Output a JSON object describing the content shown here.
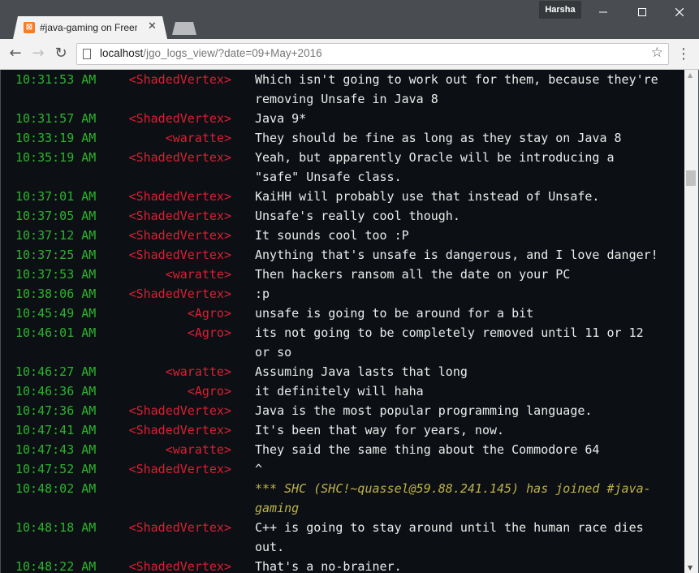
{
  "window": {
    "profile_name": "Harsha",
    "minimize_icon": "minimize-icon",
    "maximize_icon": "maximize-icon",
    "close_icon": "close-icon"
  },
  "tab": {
    "favicon_glyph": "⊠",
    "title": "#java-gaming on Freenode",
    "close_glyph": "✕"
  },
  "toolbar": {
    "back_glyph": "←",
    "forward_glyph": "→",
    "reload_glyph": "↻",
    "url_host": "localhost",
    "url_rest": "/jgo_logs_view/?date=09+May+2016",
    "star_glyph": "☆",
    "menu_glyph": "⋮"
  },
  "colors": {
    "timestamp": "#2bb52b",
    "nick": "#dc1e34",
    "message": "#ebebeb",
    "join_notice": "#bfb248",
    "log_background": "#0c1014"
  },
  "log": [
    {
      "time": "10:31:53 AM",
      "nick": "<ShadedVertex>",
      "text": "Which isn't going to work out for them, because they're removing Unsafe in Java 8"
    },
    {
      "time": "10:31:57 AM",
      "nick": "<ShadedVertex>",
      "text": "Java 9*"
    },
    {
      "time": "10:33:19 AM",
      "nick": "<waratte>",
      "text": "They should be fine as long as they stay on Java 8"
    },
    {
      "time": "10:35:19 AM",
      "nick": "<ShadedVertex>",
      "text": "Yeah, but apparently Oracle will be introducing a \"safe\" Unsafe class."
    },
    {
      "time": "10:37:01 AM",
      "nick": "<ShadedVertex>",
      "text": "KaiHH will probably use that instead of Unsafe."
    },
    {
      "time": "10:37:05 AM",
      "nick": "<ShadedVertex>",
      "text": "Unsafe's really cool though."
    },
    {
      "time": "10:37:12 AM",
      "nick": "<ShadedVertex>",
      "text": "It sounds cool too :P"
    },
    {
      "time": "10:37:25 AM",
      "nick": "<ShadedVertex>",
      "text": "Anything that's unsafe is dangerous, and I love danger!"
    },
    {
      "time": "10:37:53 AM",
      "nick": "<waratte>",
      "text": "Then hackers ransom all the date on your PC"
    },
    {
      "time": "10:38:06 AM",
      "nick": "<ShadedVertex>",
      "text": ":p"
    },
    {
      "time": "10:45:49 AM",
      "nick": "<Agro>",
      "text": "unsafe is going to be around for a bit"
    },
    {
      "time": "10:46:01 AM",
      "nick": "<Agro>",
      "text": "its not going to be completely removed until 11 or 12 or so"
    },
    {
      "time": "10:46:27 AM",
      "nick": "<waratte>",
      "text": "Assuming Java lasts that long"
    },
    {
      "time": "10:46:36 AM",
      "nick": "<Agro>",
      "text": "it definitely will haha"
    },
    {
      "time": "10:47:36 AM",
      "nick": "<ShadedVertex>",
      "text": "Java is the most popular programming language."
    },
    {
      "time": "10:47:41 AM",
      "nick": "<ShadedVertex>",
      "text": "It's been that way for years, now."
    },
    {
      "time": "10:47:43 AM",
      "nick": "<waratte>",
      "text": "They said the same thing about the Commodore 64"
    },
    {
      "time": "10:47:52 AM",
      "nick": "<ShadedVertex>",
      "text": "^"
    },
    {
      "time": "10:48:02 AM",
      "nick": "",
      "text": "*** SHC (SHC!~quassel@59.88.241.145) has joined #java-gaming",
      "type": "join"
    },
    {
      "time": "10:48:18 AM",
      "nick": "<ShadedVertex>",
      "text": "C++ is going to stay around until the human race dies out."
    },
    {
      "time": "10:48:22 AM",
      "nick": "<ShadedVertex>",
      "text": "That's a no-brainer."
    }
  ],
  "scrollbar": {
    "up_glyph": "▲",
    "down_glyph": "▼"
  }
}
